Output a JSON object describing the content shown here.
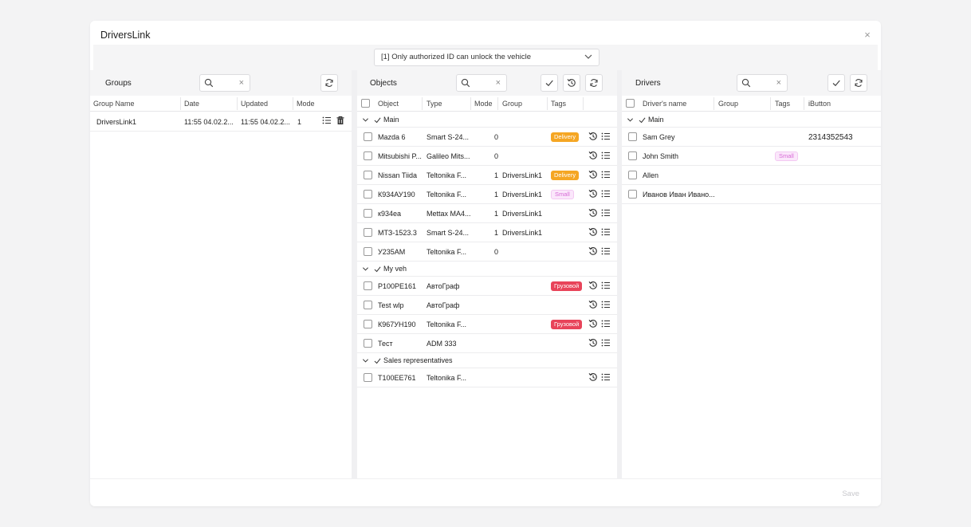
{
  "modal": {
    "title": "DriversLink",
    "close_label": "×",
    "mode_select": "[1] Only authorized ID can unlock the vehicle",
    "save_label": "Save"
  },
  "groups": {
    "title": "Groups",
    "search_placeholder": "",
    "columns": [
      "Group Name",
      "Date",
      "Updated",
      "Mode"
    ],
    "rows": [
      {
        "name": "DriversLink1",
        "date": "11:55 04.02.2...",
        "updated": "11:55 04.02.2...",
        "mode": "1"
      }
    ]
  },
  "objects": {
    "title": "Objects",
    "columns": [
      "Object",
      "Type",
      "Mode",
      "Group",
      "Tags"
    ],
    "groups": [
      {
        "label": "Main",
        "rows": [
          {
            "object": "Mazda 6",
            "type": "Smart S-24...",
            "mode": "0",
            "group": "",
            "tag": "Delivery",
            "tag_kind": "delivery"
          },
          {
            "object": "Mitsubishi P...",
            "type": "Galileo Mits...",
            "mode": "0",
            "group": "",
            "tag": "",
            "tag_kind": ""
          },
          {
            "object": "Nissan Tiida",
            "type": "Teltonika F...",
            "mode": "1",
            "group": "DriversLink1",
            "tag": "Delivery",
            "tag_kind": "delivery"
          },
          {
            "object": "К934АУ190",
            "type": "Teltonika F...",
            "mode": "1",
            "group": "DriversLink1",
            "tag": "Small",
            "tag_kind": "small"
          },
          {
            "object": "к934еа",
            "type": "Mettax MA4...",
            "mode": "1",
            "group": "DriversLink1",
            "tag": "",
            "tag_kind": ""
          },
          {
            "object": "МТЗ-1523.3",
            "type": "Smart S-24...",
            "mode": "1",
            "group": "DriversLink1",
            "tag": "",
            "tag_kind": ""
          },
          {
            "object": "У235АМ",
            "type": "Teltonika F...",
            "mode": "0",
            "group": "",
            "tag": "",
            "tag_kind": ""
          }
        ]
      },
      {
        "label": "My veh",
        "rows": [
          {
            "object": "Р100РЕ161",
            "type": "АвтоГраф",
            "mode": "",
            "group": "",
            "tag": "Грузовой",
            "tag_kind": "cargo"
          },
          {
            "object": "Test wlp",
            "type": "АвтоГраф",
            "mode": "",
            "group": "",
            "tag": "",
            "tag_kind": ""
          },
          {
            "object": "К967УН190",
            "type": "Teltonika F...",
            "mode": "",
            "group": "",
            "tag": "Грузовой",
            "tag_kind": "cargo"
          },
          {
            "object": "Тест",
            "type": "ADM 333",
            "mode": "",
            "group": "",
            "tag": "",
            "tag_kind": ""
          }
        ]
      },
      {
        "label": "Sales representatives",
        "rows": [
          {
            "object": "Т100ЕЕ761",
            "type": "Teltonika F...",
            "mode": "",
            "group": "",
            "tag": "",
            "tag_kind": ""
          }
        ]
      }
    ]
  },
  "drivers": {
    "title": "Drivers",
    "columns": [
      "Driver's name",
      "Group",
      "Tags",
      "iButton"
    ],
    "groups": [
      {
        "label": "Main",
        "rows": [
          {
            "name": "Sam Grey",
            "group": "",
            "tag": "",
            "ibutton": "2314352543"
          },
          {
            "name": "John Smith",
            "group": "",
            "tag": "Small",
            "ibutton": ""
          },
          {
            "name": "Allen",
            "group": "",
            "tag": "",
            "ibutton": ""
          },
          {
            "name": "Иванов Иван Ивано...",
            "group": "",
            "tag": "",
            "ibutton": ""
          }
        ]
      }
    ]
  },
  "icons": {
    "search": "search-icon",
    "clear": "close-icon",
    "refresh": "refresh-icon",
    "check": "check-icon",
    "history": "history-icon",
    "list": "list-icon",
    "delete": "trash-icon",
    "chevron": "chevron-down-icon"
  },
  "colors": {
    "delivery": "#f5a623",
    "small_bg": "#fbe7fb",
    "small_fg": "#d76ad6",
    "cargo": "#e8445a"
  }
}
